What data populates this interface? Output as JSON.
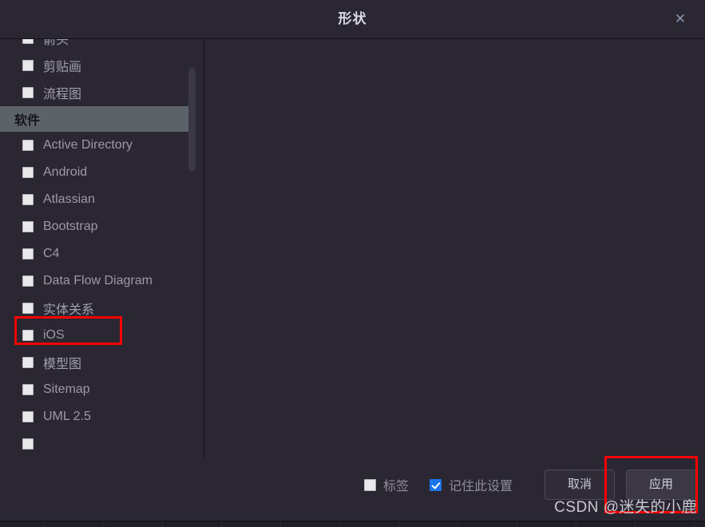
{
  "window": {
    "title": "形状",
    "close_icon": "close-icon",
    "close_glyph": "✕"
  },
  "shape_list": {
    "clipped_top_item": "",
    "items": [
      {
        "type": "item",
        "label": "箭头",
        "checked": false,
        "lang": "cn"
      },
      {
        "type": "item",
        "label": "剪贴画",
        "checked": false,
        "lang": "cn"
      },
      {
        "type": "item",
        "label": "流程图",
        "checked": false,
        "lang": "cn"
      },
      {
        "type": "section",
        "label": "软件"
      },
      {
        "type": "item",
        "label": "Active Directory",
        "checked": false,
        "lang": "en"
      },
      {
        "type": "item",
        "label": "Android",
        "checked": false,
        "lang": "en"
      },
      {
        "type": "item",
        "label": "Atlassian",
        "checked": false,
        "lang": "en"
      },
      {
        "type": "item",
        "label": "Bootstrap",
        "checked": false,
        "lang": "en"
      },
      {
        "type": "item",
        "label": "C4",
        "checked": false,
        "lang": "en"
      },
      {
        "type": "item",
        "label": "Data Flow Diagram",
        "checked": false,
        "lang": "en"
      },
      {
        "type": "item",
        "label": "实体关系",
        "checked": false,
        "lang": "cn",
        "highlighted": true
      },
      {
        "type": "item",
        "label": "iOS",
        "checked": false,
        "lang": "en"
      },
      {
        "type": "item",
        "label": "模型图",
        "checked": false,
        "lang": "cn"
      },
      {
        "type": "item",
        "label": "Sitemap",
        "checked": false,
        "lang": "en"
      },
      {
        "type": "item",
        "label": "UML 2.5",
        "checked": false,
        "lang": "en"
      },
      {
        "type": "item",
        "label": "",
        "checked": false,
        "lang": "en"
      }
    ],
    "scrollbar": {
      "visible": true
    }
  },
  "footer": {
    "label_checkbox": {
      "label": "标签",
      "checked": false
    },
    "remember_checkbox": {
      "label": "记住此设置",
      "checked": true
    },
    "cancel_button": "取消",
    "apply_button": "应用"
  },
  "annotations": {
    "entity_box_color": "#fe0000",
    "apply_box_color": "#fe0000"
  },
  "watermark": {
    "text": "CSDN @迷失的小鹿"
  },
  "colors": {
    "dialog_background": "#2a2632",
    "section_header": "#5b6268",
    "checked_accent": "#1a73e8",
    "annotation_red": "#fe0000",
    "title_text": "#d8dbe6"
  }
}
